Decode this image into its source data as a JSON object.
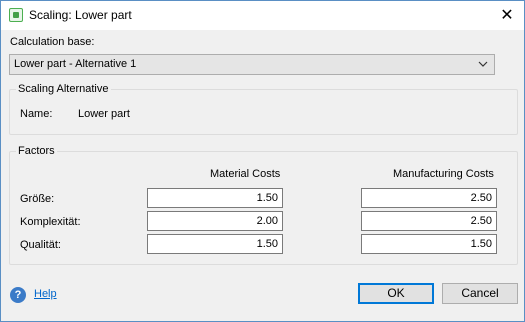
{
  "window": {
    "title": "Scaling: Lower part",
    "close_glyph": "✕"
  },
  "calc_base": {
    "label": "Calculation base:",
    "selected": "Lower part - Alternative 1"
  },
  "scaling_alternative": {
    "group_title": "Scaling Alternative",
    "name_label": "Name:",
    "name_value": "Lower part"
  },
  "factors": {
    "group_title": "Factors",
    "col_material": "Material Costs",
    "col_manufacturing": "Manufacturing Costs",
    "rows": [
      {
        "label": "Größe:",
        "material": "1.50",
        "manufacturing": "2.50"
      },
      {
        "label": "Komplexität:",
        "material": "2.00",
        "manufacturing": "2.50"
      },
      {
        "label": "Qualität:",
        "material": "1.50",
        "manufacturing": "1.50"
      }
    ]
  },
  "footer": {
    "help_icon_glyph": "?",
    "help_label": "Help",
    "ok_label": "OK",
    "cancel_label": "Cancel"
  },
  "icons": {
    "app": "scaling-app-icon",
    "close": "close-icon",
    "dropdown": "chevron-down-icon",
    "help": "help-icon"
  },
  "colors": {
    "accent": "#0078d7",
    "link": "#0066cc",
    "help_icon": "#3b7bc8"
  }
}
